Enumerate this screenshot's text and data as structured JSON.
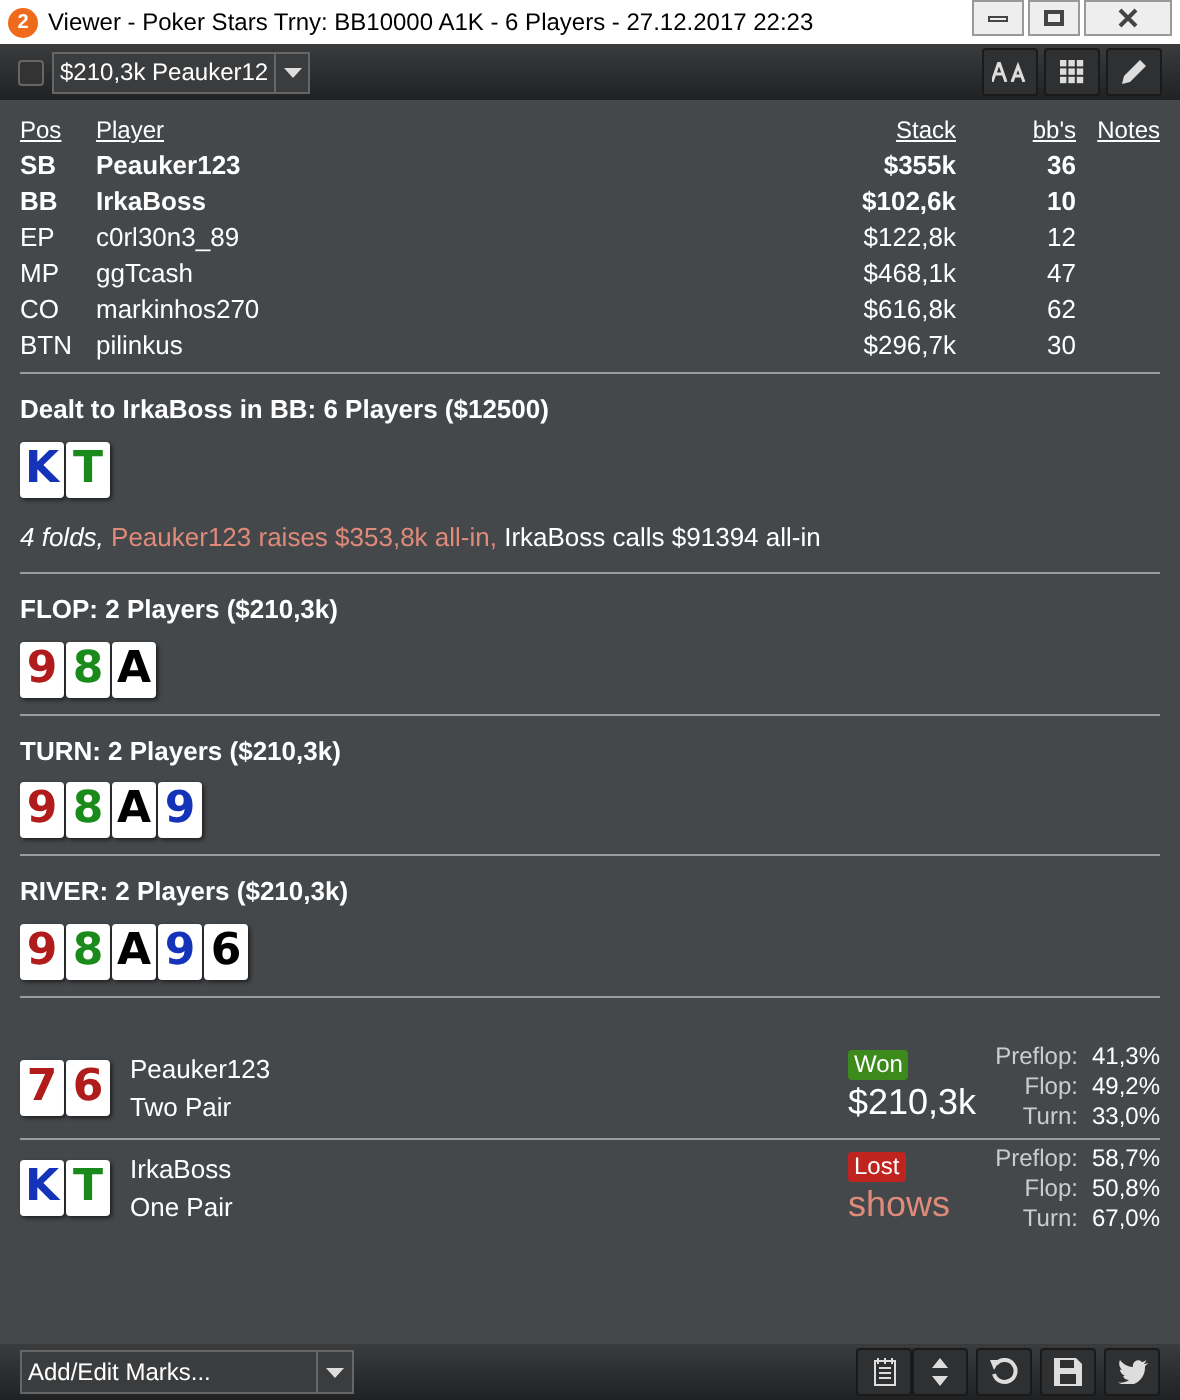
{
  "window": {
    "title": "Viewer - Poker Stars Trny: BB10000 A1K - 6 Players - 27.12.2017 22:23",
    "badge": "2"
  },
  "toolbar": {
    "checked": false,
    "hand_select": "$210,3k Peauker12"
  },
  "table": {
    "columns": [
      "Pos",
      "Player",
      "Stack",
      "bb's",
      "Notes"
    ],
    "rows": [
      {
        "pos": "SB",
        "player": "Peauker123",
        "stack": "$355k",
        "bbs": "36",
        "bold": true
      },
      {
        "pos": "BB",
        "player": "IrkaBoss",
        "stack": "$102,6k",
        "bbs": "10",
        "bold": true
      },
      {
        "pos": "EP",
        "player": "c0rl30n3_89",
        "stack": "$122,8k",
        "bbs": "12",
        "bold": false
      },
      {
        "pos": "MP",
        "player": "ggTcash",
        "stack": "$468,1k",
        "bbs": "47",
        "bold": false
      },
      {
        "pos": "CO",
        "player": "markinhos270",
        "stack": "$616,8k",
        "bbs": "62",
        "bold": false
      },
      {
        "pos": "BTN",
        "player": "pilinkus",
        "stack": "$296,7k",
        "bbs": "30",
        "bold": false
      }
    ]
  },
  "streets": [
    {
      "title": "Dealt to IrkaBoss in BB: 6 Players ($12500)",
      "cards": [
        {
          "rank": "K",
          "color": "#1533b8"
        },
        {
          "rank": "T",
          "color": "#1a8a1a"
        }
      ],
      "actions": [
        {
          "kind": "folds",
          "text": "4 folds, "
        },
        {
          "kind": "raise",
          "text": "Peauker123 raises $353,8k all-in, "
        },
        {
          "kind": "call",
          "text": "IrkaBoss calls $91394 all-in"
        }
      ]
    },
    {
      "title": "FLOP: 2 Players ($210,3k)",
      "cards": [
        {
          "rank": "9",
          "color": "#b01c1c"
        },
        {
          "rank": "8",
          "color": "#1a8a1a"
        },
        {
          "rank": "A",
          "color": "#000000"
        }
      ]
    },
    {
      "title": "TURN: 2 Players ($210,3k)",
      "cards": [
        {
          "rank": "9",
          "color": "#b01c1c"
        },
        {
          "rank": "8",
          "color": "#1a8a1a"
        },
        {
          "rank": "A",
          "color": "#000000"
        },
        {
          "rank": "9",
          "color": "#1533b8"
        }
      ]
    },
    {
      "title": "RIVER: 2 Players ($210,3k)",
      "cards": [
        {
          "rank": "9",
          "color": "#b01c1c"
        },
        {
          "rank": "8",
          "color": "#1a8a1a"
        },
        {
          "rank": "A",
          "color": "#000000"
        },
        {
          "rank": "9",
          "color": "#1533b8"
        },
        {
          "rank": "6",
          "color": "#000000"
        }
      ]
    }
  ],
  "results": [
    {
      "cards": [
        {
          "rank": "7",
          "color": "#b01c1c"
        },
        {
          "rank": "6",
          "color": "#b01c1c"
        }
      ],
      "player": "Peauker123",
      "hand": "Two Pair",
      "won": true,
      "badge": "Won",
      "amount": "$210,3k",
      "equity": [
        {
          "label": "Preflop:",
          "value": "41,3%"
        },
        {
          "label": "Flop:",
          "value": "49,2%"
        },
        {
          "label": "Turn:",
          "value": "33,0%"
        }
      ]
    },
    {
      "cards": [
        {
          "rank": "K",
          "color": "#1533b8"
        },
        {
          "rank": "T",
          "color": "#1a8a1a"
        }
      ],
      "player": "IrkaBoss",
      "hand": "One Pair",
      "won": false,
      "badge": "Lost",
      "amount": "shows",
      "equity": [
        {
          "label": "Preflop:",
          "value": "58,7%"
        },
        {
          "label": "Flop:",
          "value": "50,8%"
        },
        {
          "label": "Turn:",
          "value": "67,0%"
        }
      ]
    }
  ],
  "bottom_bar": {
    "marks_select": "Add/Edit Marks..."
  }
}
